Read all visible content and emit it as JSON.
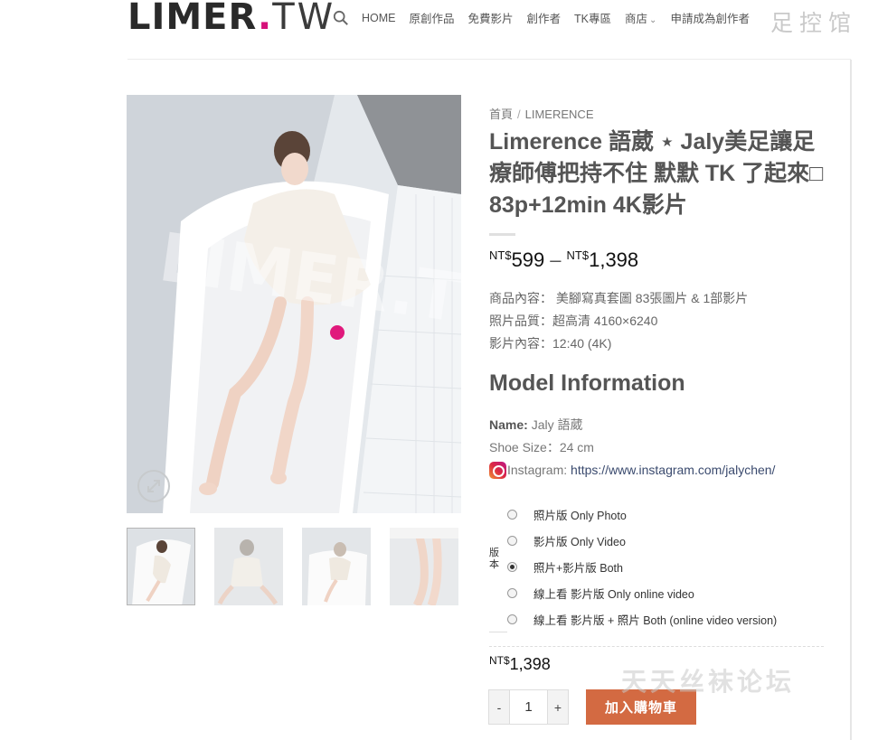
{
  "header": {
    "logo_main": "LIMER",
    "logo_dot": ".",
    "logo_tw": "TW",
    "nav": {
      "home": "HOME",
      "original": "原創作品",
      "free_video": "免費影片",
      "creators": "創作者",
      "tk": "TK專區",
      "shop": "商店",
      "apply": "申請成為創作者"
    },
    "watermark": "足控馆"
  },
  "breadcrumb": {
    "home": "首頁",
    "separator": "/",
    "category": "LIMERENCE"
  },
  "product": {
    "title": "Limerence 語葳 ⋆ Jaly美足讓足療師傅把持不住 默默 TK 了起來□ 83p+12min 4K影片",
    "price_min_currency": "NT$",
    "price_min": "599",
    "price_dash": "–",
    "price_max_currency": "NT$",
    "price_max": "1,398",
    "desc": [
      "商品內容： 美腳寫真套圖 83張圖片 & 1部影片",
      "照片品質：超高清 4160×6240",
      "影片內容：12:40 (4K)"
    ]
  },
  "model": {
    "heading": "Model Information",
    "name_label": "Name:",
    "name_value": "Jaly 語葳",
    "shoe_size": "Shoe Size：24 cm",
    "instagram_label": "Instagram:",
    "instagram_url": "https://www.instagram.com/jalychen/"
  },
  "options": {
    "label": "版本",
    "items": [
      {
        "label": "照片版 Only Photo",
        "checked": false
      },
      {
        "label": "影片版 Only Video",
        "checked": false
      },
      {
        "label": "照片+影片版 Both",
        "checked": true
      },
      {
        "label": "線上看 影片版 Only online video",
        "checked": false
      },
      {
        "label": "線上看 影片版 + 照片 Both (online video version)",
        "checked": false
      }
    ]
  },
  "cart": {
    "final_currency": "NT$",
    "final_price": "1,398",
    "minus": "-",
    "quantity": "1",
    "plus": "+",
    "add_to_cart": "加入購物車"
  },
  "footer_watermark": "天天丝袜论坛",
  "colors": {
    "accent": "#d36a42",
    "logo_dot": "#d6127a",
    "heading": "#555555"
  },
  "icons": [
    "search-icon",
    "chevron-down-icon",
    "zoom-expand-icon",
    "instagram-icon"
  ]
}
